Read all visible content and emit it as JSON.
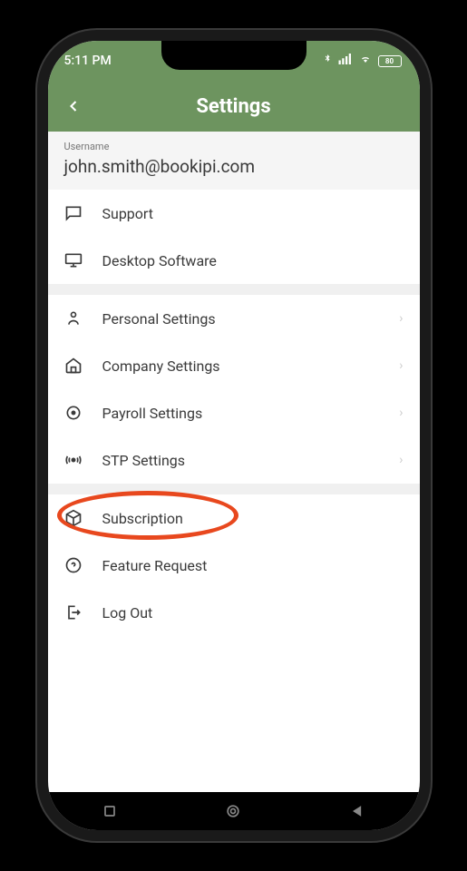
{
  "status": {
    "time": "5:11 PM",
    "battery": "80"
  },
  "header": {
    "title": "Settings"
  },
  "user": {
    "label": "Username",
    "email": "john.smith@bookipi.com"
  },
  "menu": {
    "support": "Support",
    "desktop": "Desktop Software",
    "personal": "Personal Settings",
    "company": "Company Settings",
    "payroll": "Payroll Settings",
    "stp": "STP Settings",
    "subscription": "Subscription",
    "feature": "Feature Request",
    "logout": "Log Out"
  }
}
